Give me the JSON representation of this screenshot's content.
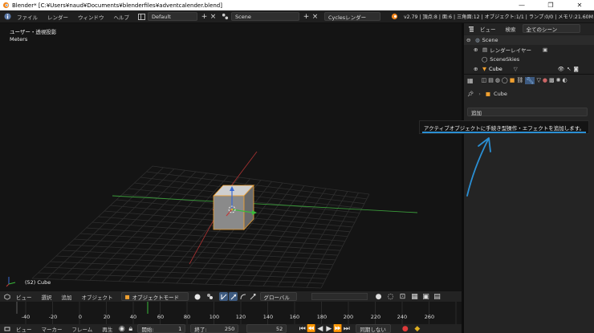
{
  "window": {
    "title": "Blender* [C:¥Users¥naud¥Documents¥blenderfiles¥adventcalender.blend]",
    "minimize_glyph": "—",
    "restore_glyph": "❐",
    "close_glyph": "✕"
  },
  "info_header": {
    "menus": [
      "ファイル",
      "レンダー",
      "ウィンドウ",
      "ヘルプ"
    ],
    "layout": "Default",
    "scene": "Scene",
    "engine": "Cyclesレンダー",
    "stats": "v2.79 | 頂点:8 | 面:6 | 三角面:12 | オブジェクト:1/1 | ランプ:0/0 | メモリ:21.60M"
  },
  "viewport": {
    "view_name": "ユーザー・透視投影",
    "units": "Meters",
    "object_label": "(52) Cube"
  },
  "view3d_header": {
    "menus": [
      "ビュー",
      "選択",
      "追加",
      "オブジェクト"
    ],
    "mode": "オブジェクトモード",
    "orientation": "グローバル"
  },
  "timeline": {
    "ticks": [
      "-40",
      "-20",
      "0",
      "20",
      "40",
      "60",
      "80",
      "100",
      "120",
      "140",
      "160",
      "180",
      "200",
      "220",
      "240",
      "260"
    ],
    "current_frame_marker": 52
  },
  "timeline_header": {
    "menus": [
      "ビュー",
      "マーカー",
      "フレーム",
      "再生"
    ],
    "start_label": "開始:",
    "start_value": "1",
    "end_label": "終了:",
    "end_value": "250",
    "current_frame": "52",
    "sync": "同期しない"
  },
  "outliner": {
    "menus": [
      "ビュー",
      "検索"
    ],
    "filter": "全てのシーン",
    "rows": [
      "Scene",
      "レンダーレイヤー",
      "SceneSkies",
      "Cube"
    ]
  },
  "properties": {
    "breadcrumb_object": "Cube",
    "panel_label": "追加",
    "tooltip": "アクティブオブジェクトに手続き型操作・エフェクトを追加します。"
  },
  "colors": {
    "accent_blue": "#2a8fd4",
    "object_orange": "#f0a030",
    "grid_line": "#2f2f2f",
    "axis_x": "#a03030",
    "axis_y": "#3a9a3a"
  },
  "icons": {
    "blender_logo": "blender-icon",
    "info_editor": "info-icon",
    "add": "plus-icon",
    "close": "close-icon"
  }
}
